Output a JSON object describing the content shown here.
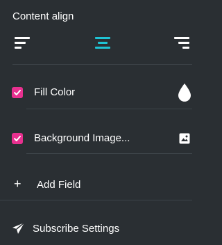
{
  "content_align": {
    "title": "Content align",
    "options": [
      {
        "name": "left",
        "icon": "align-left-icon",
        "active": false
      },
      {
        "name": "center",
        "icon": "align-center-icon",
        "active": true
      },
      {
        "name": "right",
        "icon": "align-right-icon",
        "active": false
      }
    ],
    "active_color": "#1fc3d4"
  },
  "fields": [
    {
      "label": "Fill Color",
      "checked": true,
      "icon": "droplet-icon"
    },
    {
      "label": "Background Image...",
      "checked": true,
      "icon": "image-icon"
    }
  ],
  "add_field": {
    "label": "Add Field",
    "icon": "plus-icon"
  },
  "subscribe_settings": {
    "label": "Subscribe Settings",
    "icon": "send-icon"
  },
  "colors": {
    "background": "#2a2f33",
    "divider": "#3d4449",
    "checkbox": "#e8308f",
    "text": "#ffffff"
  }
}
